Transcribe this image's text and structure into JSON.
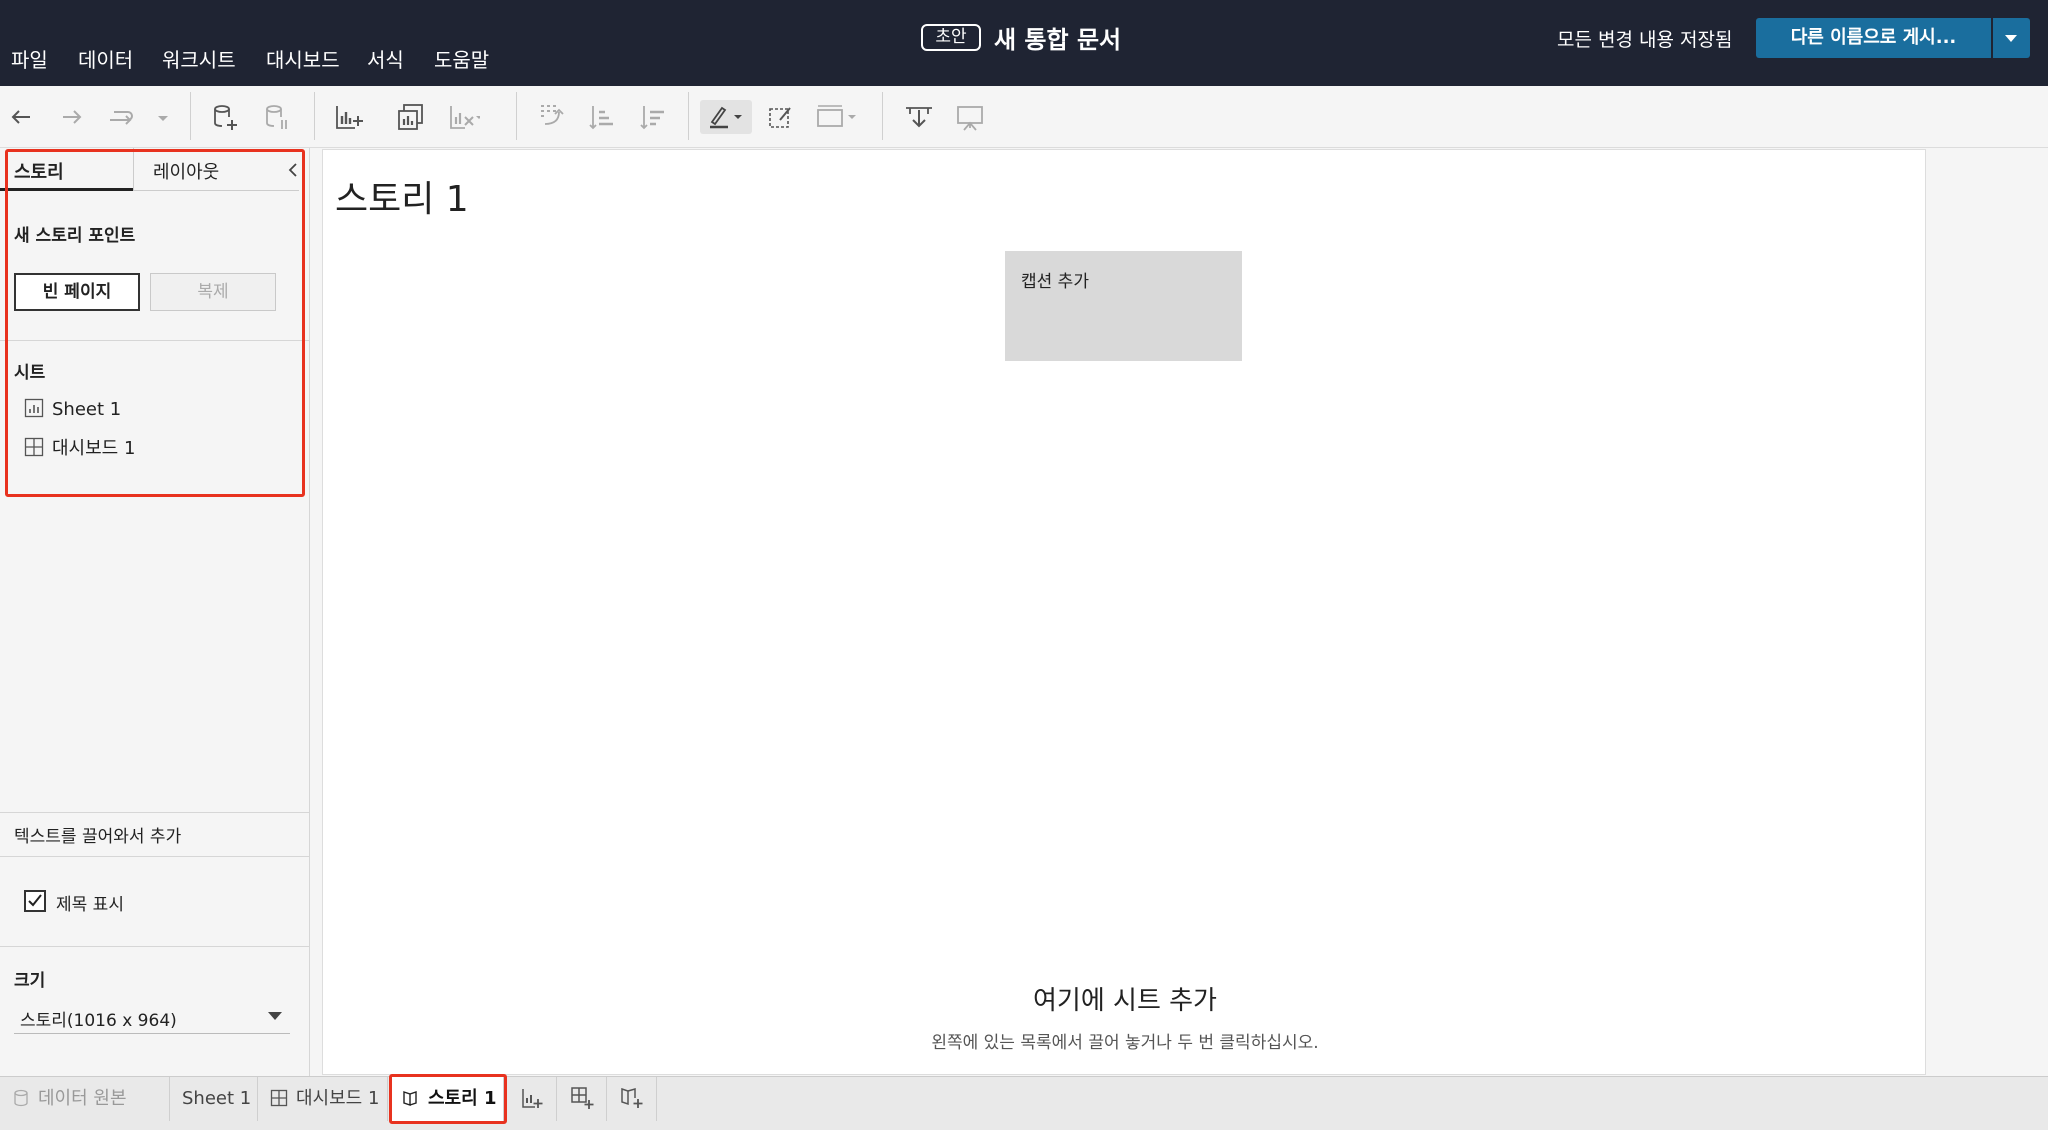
{
  "menu": [
    "파일",
    "데이터",
    "워크시트",
    "대시보드",
    "서식",
    "도움말"
  ],
  "header": {
    "draft_badge": "초안",
    "doc_title": "새 통합 문서",
    "saved_status": "모든 변경 내용 저장됨",
    "publish_label": "다른 이름으로 게시..."
  },
  "left_panel": {
    "tab_story": "스토리",
    "tab_layout": "레이아웃",
    "new_story_point": "새 스토리 포인트",
    "blank_page_button": "빈 페이지",
    "duplicate_button": "복제",
    "sheets_label": "시트",
    "sheets": [
      "Sheet 1",
      "대시보드 1"
    ],
    "drag_text": "텍스트를 끌어와서 추가",
    "show_title": "제목 표시",
    "size_label": "크기",
    "size_value": "스토리(1016 x 964)"
  },
  "canvas": {
    "story_title": "스토리 1",
    "caption": "캡션 추가",
    "add_sheet_title": "여기에 시트 추가",
    "add_sheet_hint": "왼쪽에 있는 목록에서 끌어 놓거나 두 번 클릭하십시오."
  },
  "bottom_tabs": {
    "data_source": "데이터 원본",
    "sheet1": "Sheet 1",
    "dashboard1": "대시보드 1",
    "story1": "스토리 1"
  },
  "colors": {
    "topbar": "#1f2433",
    "publish": "#1a6e9e",
    "highlight": "#e8321f"
  }
}
